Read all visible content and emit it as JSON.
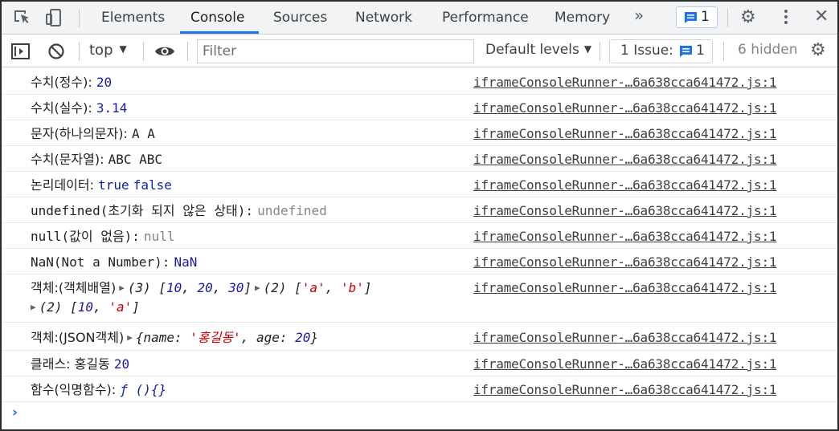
{
  "tabs": {
    "items": [
      "Elements",
      "Console",
      "Sources",
      "Network",
      "Performance",
      "Memory"
    ],
    "more": "»",
    "issue_badge_count": "1"
  },
  "toolbar": {
    "context": "top",
    "filter_placeholder": "Filter",
    "levels": "Default levels",
    "issues_label": "1 Issue:",
    "issues_count": "1",
    "hidden": "6 hidden"
  },
  "messages": [
    {
      "label": "수치(정수):",
      "value": "20",
      "source": "iframeConsoleRunner-…6a638cca641472.js:1"
    },
    {
      "label": "수치(실수):",
      "value": "3.14",
      "source": "iframeConsoleRunner-…6a638cca641472.js:1"
    },
    {
      "label": "문자(하나의문자):",
      "value": "A A",
      "source": "iframeConsoleRunner-…6a638cca641472.js:1"
    },
    {
      "label": "수치(문자열):",
      "value": "ABC ABC",
      "source": "iframeConsoleRunner-…6a638cca641472.js:1"
    },
    {
      "label": "논리데이터:",
      "value_true": "true",
      "value_false": "false",
      "source": "iframeConsoleRunner-…6a638cca641472.js:1"
    },
    {
      "label": "undefined(초기화 되지 않은 상태):",
      "value": "undefined",
      "source": "iframeConsoleRunner-…6a638cca641472.js:1"
    },
    {
      "label": "null(값이 없음):",
      "value": "null",
      "source": "iframeConsoleRunner-…6a638cca641472.js:1"
    },
    {
      "label": "NaN(Not a Number):",
      "value": "NaN",
      "source": "iframeConsoleRunner-…6a638cca641472.js:1"
    },
    {
      "label": "객체:(객체배열)",
      "array1_len": "(3)",
      "array1_open": "[",
      "array1_items": [
        "10",
        "20",
        "30"
      ],
      "array1_close": "]",
      "array2_len": "(2)",
      "array2_items": [
        "'a'",
        "'b'"
      ],
      "array3_len": "(2)",
      "array3_num": "10",
      "array3_str": "'a'",
      "source": "iframeConsoleRunner-…6a638cca641472.js:1"
    },
    {
      "label": "객체:(JSON객체)",
      "key1": "name",
      "val1": "'홍길동'",
      "key2": "age",
      "val2": "20",
      "source": "iframeConsoleRunner-…6a638cca641472.js:1"
    },
    {
      "label": "클래스:",
      "name": "홍길동",
      "age": "20",
      "source": "iframeConsoleRunner-…6a638cca641472.js:1"
    },
    {
      "label": "함수(익명함수):",
      "value": "ƒ (){}",
      "source": "iframeConsoleRunner-…6a638cca641472.js:1"
    }
  ],
  "prompt": "›",
  "colors": {
    "accent": "#1a73e8",
    "number": "#1a1aa6",
    "string": "#c80000",
    "keyword": "#0d22aa"
  }
}
